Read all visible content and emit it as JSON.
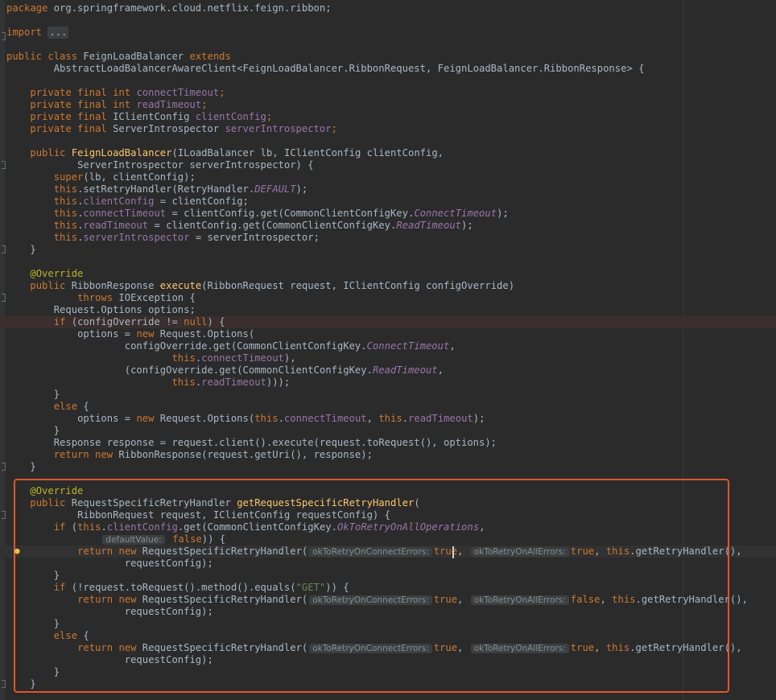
{
  "editor": {
    "package_line": [
      "package",
      " org.springframework.cloud.netflix.feign.ribbon;"
    ],
    "import_kw": "import",
    "import_fold": "...",
    "class_decl": [
      "public class",
      " FeignLoadBalancer ",
      "extends"
    ],
    "class_extends": "AbstractLoadBalancerAwareClient<FeignLoadBalancer.RibbonRequest, FeignLoadBalancer.RibbonResponse> {",
    "fields": [
      {
        "kw": "private final int",
        "name": "connectTimeout",
        "end": ";"
      },
      {
        "kw": "private final int",
        "name": "readTimeout",
        "end": ";"
      },
      {
        "kw": "private final",
        "type": " IClientConfig ",
        "name": "clientConfig",
        "end": ";"
      },
      {
        "kw": "private final",
        "type": " ServerIntrospector ",
        "name": "serverIntrospector",
        "end": ";"
      }
    ],
    "ctor": {
      "kw": "public",
      "name": "FeignLoadBalancer",
      "params1": "(ILoadBalancer lb, IClientConfig clientConfig,",
      "params2": "ServerIntrospector serverIntrospector) {",
      "super_kw": "super",
      "super_args": "(lb, clientConfig);",
      "this_kw": "this",
      "retry_a": ".setRetryHandler(RetryHandler.",
      "retry_const": "DEFAULT",
      "retry_b": ");",
      "assign_clientConfig": " = clientConfig;",
      "assign_connect_a": " = clientConfig.get(CommonClientConfigKey.",
      "connect_const": "ConnectTimeout",
      "read_const": "ReadTimeout",
      "assign_end": ");",
      "assign_server": " = serverIntrospector;",
      "close": "}"
    },
    "execute": {
      "annotation": "@Override",
      "kw": "public",
      "ret": " RibbonResponse ",
      "name": "execute",
      "params": "(RibbonRequest request, IClientConfig configOverride)",
      "throws_kw": "throws",
      "throws_rest": " IOException {",
      "opts_decl": "Request.Options options;",
      "if_kw": "if",
      "if_cond_a": " (configOverride != ",
      "null_kw": "null",
      "if_cond_b": ") {",
      "opts_assign": "options = ",
      "new_kw": "new",
      "opts_new": " Request.Options(",
      "cfg_get": "configOverride.get(CommonClientConfigKey.",
      "comma": ",",
      "close_paren_comma": "),",
      "cfg_get2": "(configOverride.get(CommonClientConfigKey.",
      "close_triple": ")));",
      "else_kw": "else",
      "else_open": " {",
      "opts_plain_a": " Request.Options(",
      "opts_plain_b": ", ",
      "opts_plain_c": ");",
      "resp": "Response response = request.client().execute(request.toRequest(), options);",
      "return_kw": "return",
      "return_rest": " RibbonResponse(request.getUri(), response);"
    },
    "retry": {
      "annotation": "@Override",
      "kw": "public",
      "ret": " RequestSpecificRetryHandler ",
      "name": "getRequestSpecificRetryHandler",
      "open": "(",
      "params": "RibbonRequest request, IClientConfig requestConfig) {",
      "if_a": " (",
      "client_get": ".get(CommonClientConfigKey.",
      "ok_all_const": "OkToRetryOnAllOperations",
      "default_hint": "defaultValue:",
      "false_kw": "false",
      "if_close": ")) {",
      "ctor_name": " RequestSpecificRetryHandler(",
      "hint_conn": "okToRetryOnConnectErrors:",
      "hint_all": "okToRetryOnAllErrors:",
      "true_kw": "true",
      "get_handler": ".getRetryHandler(),",
      "req_config": "requestConfig);",
      "if2_a": " (!request.toRequest().method().equals(",
      "get_str": "\"GET\"",
      "if2_b": ")) {"
    }
  }
}
